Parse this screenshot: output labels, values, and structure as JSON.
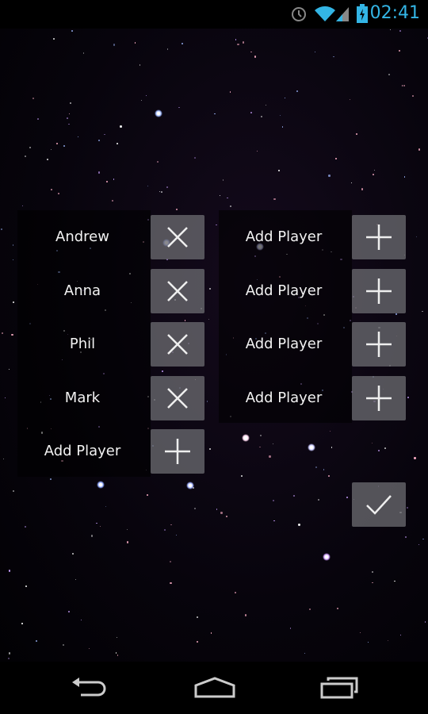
{
  "status_bar": {
    "time": "02:41",
    "icons": [
      "alarm-icon",
      "wifi-icon",
      "signal-icon",
      "battery-charging-icon"
    ],
    "accent": "#33b5e5"
  },
  "left_column": {
    "rows": [
      {
        "label": "Andrew",
        "action": "remove",
        "icon": "close-icon"
      },
      {
        "label": "Anna",
        "action": "remove",
        "icon": "close-icon"
      },
      {
        "label": "Phil",
        "action": "remove",
        "icon": "close-icon"
      },
      {
        "label": "Mark",
        "action": "remove",
        "icon": "close-icon"
      },
      {
        "label": "Add Player",
        "action": "add",
        "icon": "plus-icon"
      }
    ]
  },
  "right_column": {
    "rows": [
      {
        "label": "Add Player",
        "action": "add",
        "icon": "plus-icon"
      },
      {
        "label": "Add Player",
        "action": "add",
        "icon": "plus-icon"
      },
      {
        "label": "Add Player",
        "action": "add",
        "icon": "plus-icon"
      },
      {
        "label": "Add Player",
        "action": "add",
        "icon": "plus-icon"
      }
    ]
  },
  "confirm": {
    "icon": "checkmark-icon"
  },
  "nav_bar": {
    "icons": [
      "back-icon",
      "home-icon",
      "recent-apps-icon"
    ]
  }
}
